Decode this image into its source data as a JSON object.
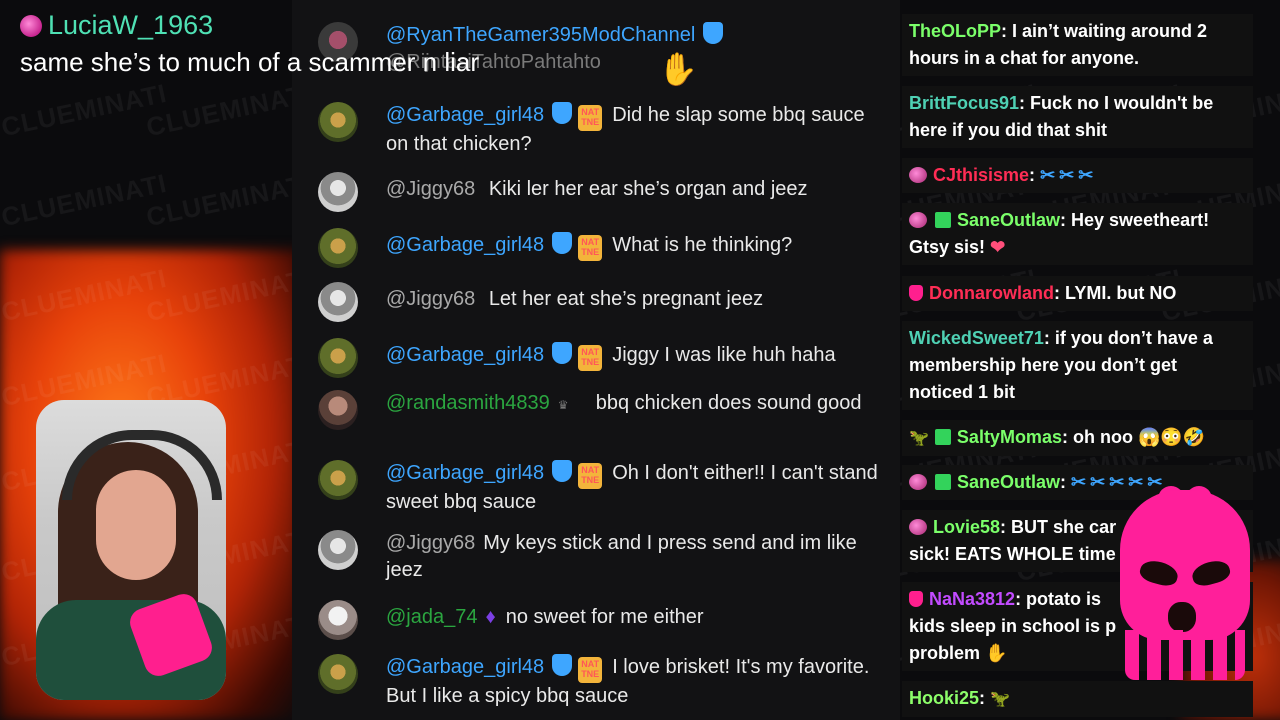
{
  "overlay": {
    "username": "LuciaW_1963",
    "message": "same she’s to much of a scammer n liar"
  },
  "watermark_text": "CLUEMINATI",
  "center_chat": [
    {
      "user": "@RyanTheGamer395ModChannel",
      "text": "",
      "ghost": "@RijntasiTahtoPahtahto",
      "avatar": "ryan"
    },
    {
      "user": "@Garbage_girl48",
      "text": "Did he slap some bbq sauce on that chicken?",
      "avatar": "garbage",
      "mod": "NAT\nTNE"
    },
    {
      "user": "@Jiggy68",
      "text": "Kiki ler her ear she’s organ and jeez",
      "avatar": "jiggy"
    },
    {
      "user": "@Garbage_girl48",
      "text": "What is he thinking?",
      "avatar": "garbage",
      "mod": "NAT\nTNE"
    },
    {
      "user": "@Jiggy68",
      "text": "Let her eat she’s pregnant jeez",
      "avatar": "jiggy"
    },
    {
      "user": "@Garbage_girl48",
      "text": "Jiggy I was like huh haha",
      "avatar": "garbage",
      "mod": "NAT\nTNE"
    },
    {
      "user": "@randasmith4839",
      "text": "bbq chicken does sound good",
      "avatar": "randa"
    },
    {
      "user": "@Garbage_girl48",
      "text": "Oh I don't either!! I can't stand sweet bbq sauce",
      "avatar": "garbage",
      "mod": "NAT\nTNE"
    },
    {
      "user": "@Jiggy68",
      "text": "My keys stick and I press send and im like jeez",
      "avatar": "jiggy"
    },
    {
      "user": "@jada_74",
      "text": "no sweet for me either",
      "avatar": "jada"
    },
    {
      "user": "@Garbage_girl48",
      "text": "I love brisket! It's my favorite. But I like a spicy bbq sauce",
      "avatar": "garbage",
      "mod": "NAT\nTNE"
    }
  ],
  "right_chat": [
    {
      "user": "TheOLoPP",
      "text": ": I ain’t waiting around 2 hours in a chat for anyone."
    },
    {
      "user": "BrittFocus91",
      "text": ": Fuck no I wouldn't be here if you did that shit"
    },
    {
      "user": "CJthisisme",
      "text": ":"
    },
    {
      "user": "SaneOutlaw",
      "text": ": Hey sweetheart! Gtsy sis!"
    },
    {
      "user": "Donnarowland",
      "text": ": LYMI. but NO"
    },
    {
      "user": "WickedSweet71",
      "text": ": if you don’t have a membership here you don’t get noticed 1 bit"
    },
    {
      "user": "SaltyMomas",
      "text": ": oh noo"
    },
    {
      "user": "SaneOutlaw",
      "text": ":"
    },
    {
      "user": "Lovie58",
      "text": ": BUT she car",
      "text2": "sick! EATS WHOLE time"
    },
    {
      "user": "NaNa3812",
      "text": ": potato is",
      "text2": "kids sleep in school is p",
      "text3": "problem"
    },
    {
      "user": "Hooki25",
      "text": ":"
    }
  ]
}
